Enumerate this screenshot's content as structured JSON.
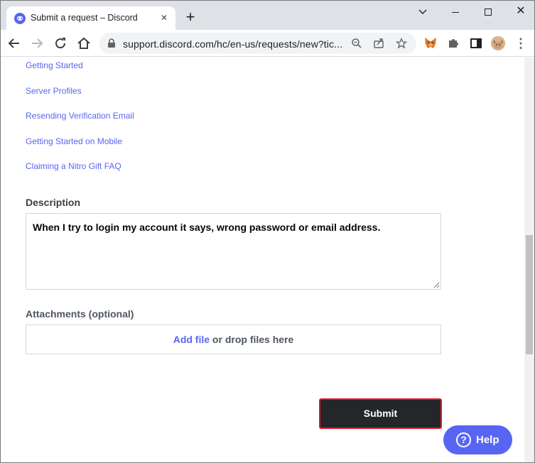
{
  "browser": {
    "tab_title": "Submit a request – Discord",
    "tab_close_glyph": "✕",
    "new_tab_glyph": "+",
    "url": "support.discord.com/hc/en-us/requests/new?tic...",
    "window_close_glyph": "✕",
    "window_chevron_glyph": "⌄",
    "menu_glyph": "⋮",
    "icons": [
      "back-icon",
      "forward-icon",
      "reload-icon",
      "home-icon",
      "lock-icon",
      "zoom-icon",
      "share-icon",
      "star-icon",
      "metamask-fox-icon",
      "puzzle-icon",
      "side-panel-icon",
      "profile-avatar"
    ]
  },
  "page": {
    "suggested_articles": [
      "Getting Started",
      "Server Profiles",
      "Resending Verification Email",
      "Getting Started on Mobile",
      "Claiming a Nitro Gift FAQ"
    ],
    "description_label": "Description",
    "description_value": "When I try to login my account it says, wrong password or email address.",
    "attachments_label": "Attachments (optional)",
    "add_file_label": "Add file",
    "drop_files_label": " or drop files here",
    "submit_label": "Submit",
    "help_label": "Help",
    "help_icon_glyph": "?"
  },
  "colors": {
    "accent": "#5865f2",
    "submit_bg": "#23272a",
    "submit_border": "#e0182a"
  }
}
